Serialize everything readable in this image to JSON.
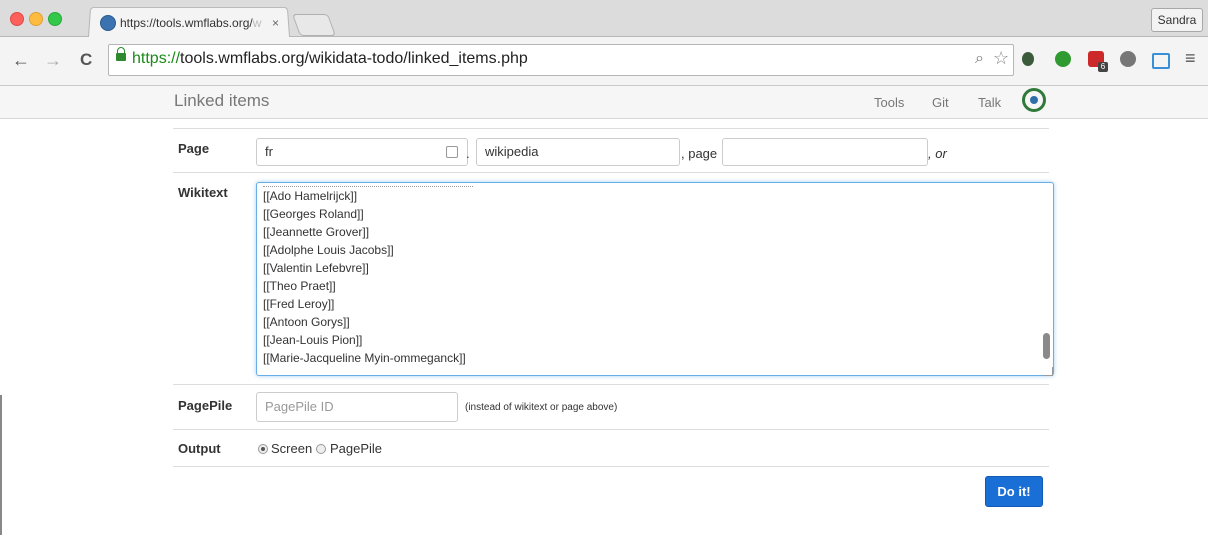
{
  "browser": {
    "tab_title": "https://tools.wmflabs.org/",
    "tab_title_faded": "w",
    "tab_close": "×",
    "user_label": "Sandra",
    "url_scheme": "https://",
    "url_rest": "tools.wmflabs.org/wikidata-todo/linked_items.php",
    "nav_back": "←",
    "nav_forward": "→",
    "nav_reload": "C",
    "zoom_icon": "⌕",
    "star_icon": "☆",
    "menu_icon": "≡",
    "ext_badge": "6"
  },
  "site": {
    "brand": "Linked items",
    "nav": [
      "Tools",
      "Git",
      "Talk"
    ]
  },
  "form": {
    "page_label": "Page",
    "lang_value": "fr",
    "dot": ".",
    "project_value": "wikipedia",
    "page_sep": ", page",
    "or_text": ", or",
    "wikitext_label": "Wikitext",
    "wikitext_lines": [
      "[[Ado Hamelrijck]]",
      "[[Georges Roland]]",
      "[[Jeannette Grover]]",
      "[[Adolphe Louis Jacobs]]",
      "[[Valentin Lefebvre]]",
      "[[Theo Praet]]",
      "[[Fred Leroy]]",
      "[[Antoon Gorys]]",
      "[[Jean-Louis Pion]]",
      "[[Marie-Jacqueline Myin-ommeganck]]"
    ],
    "pagepile_label": "PagePile",
    "pagepile_placeholder": "PagePile ID",
    "pagepile_hint": "(instead of wikitext or page above)",
    "output_label": "Output",
    "output_options": [
      "Screen",
      "PagePile"
    ],
    "output_selected": "Screen",
    "submit_label": "Do it!"
  }
}
